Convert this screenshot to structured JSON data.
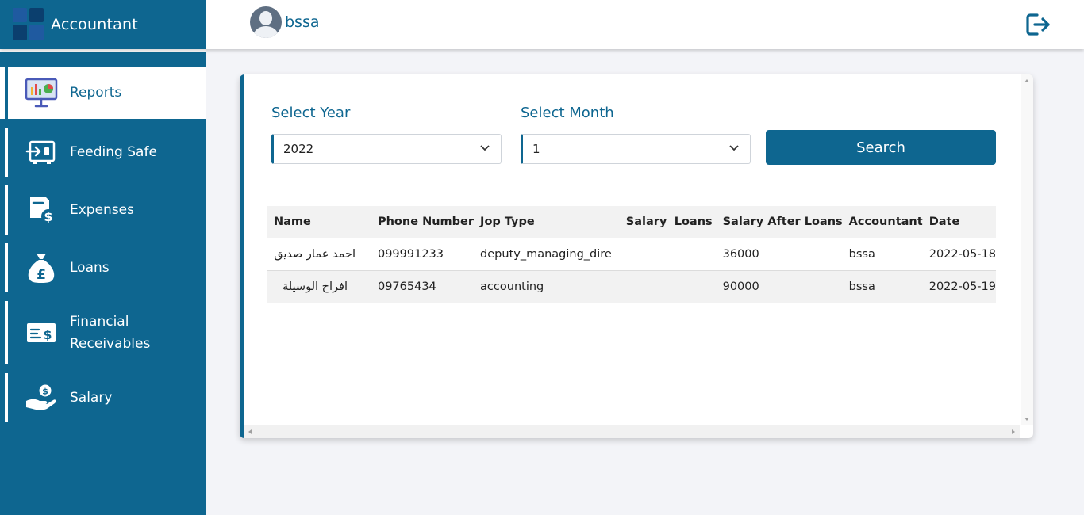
{
  "app": {
    "title": "Accountant"
  },
  "user": {
    "name": "bssa"
  },
  "sidebar": {
    "items": [
      {
        "label": "Reports",
        "active": true,
        "icon": "presentation-chart-icon"
      },
      {
        "label": "Feeding Safe",
        "active": false,
        "icon": "safe-deposit-icon"
      },
      {
        "label": "Expenses",
        "active": false,
        "icon": "expense-document-icon"
      },
      {
        "label": "Loans",
        "active": false,
        "icon": "money-bag-icon"
      },
      {
        "label": "Financial Receivables",
        "active": false,
        "icon": "cheque-icon"
      },
      {
        "label": "Salary",
        "active": false,
        "icon": "hand-coin-icon"
      }
    ]
  },
  "filters": {
    "year_label": "Select Year",
    "year_value": "2022",
    "month_label": "Select Month",
    "month_value": "1",
    "search_label": "Search"
  },
  "table": {
    "columns": [
      "Name",
      "Phone Number",
      "Jop Type",
      "Salary",
      "Loans",
      "Salary After Loans",
      "Accountant",
      "Date"
    ],
    "rows": [
      [
        "احمد عمار صديق",
        "099991233",
        "deputy_managing_dire",
        "",
        "",
        "36000",
        "bssa",
        "2022-05-18"
      ],
      [
        "افراح الوسيلة",
        "09765434",
        "accounting",
        "",
        "",
        "90000",
        "bssa",
        "2022-05-19"
      ]
    ]
  },
  "colors": {
    "primary": "#0e6690",
    "background": "#f3f4f8"
  }
}
